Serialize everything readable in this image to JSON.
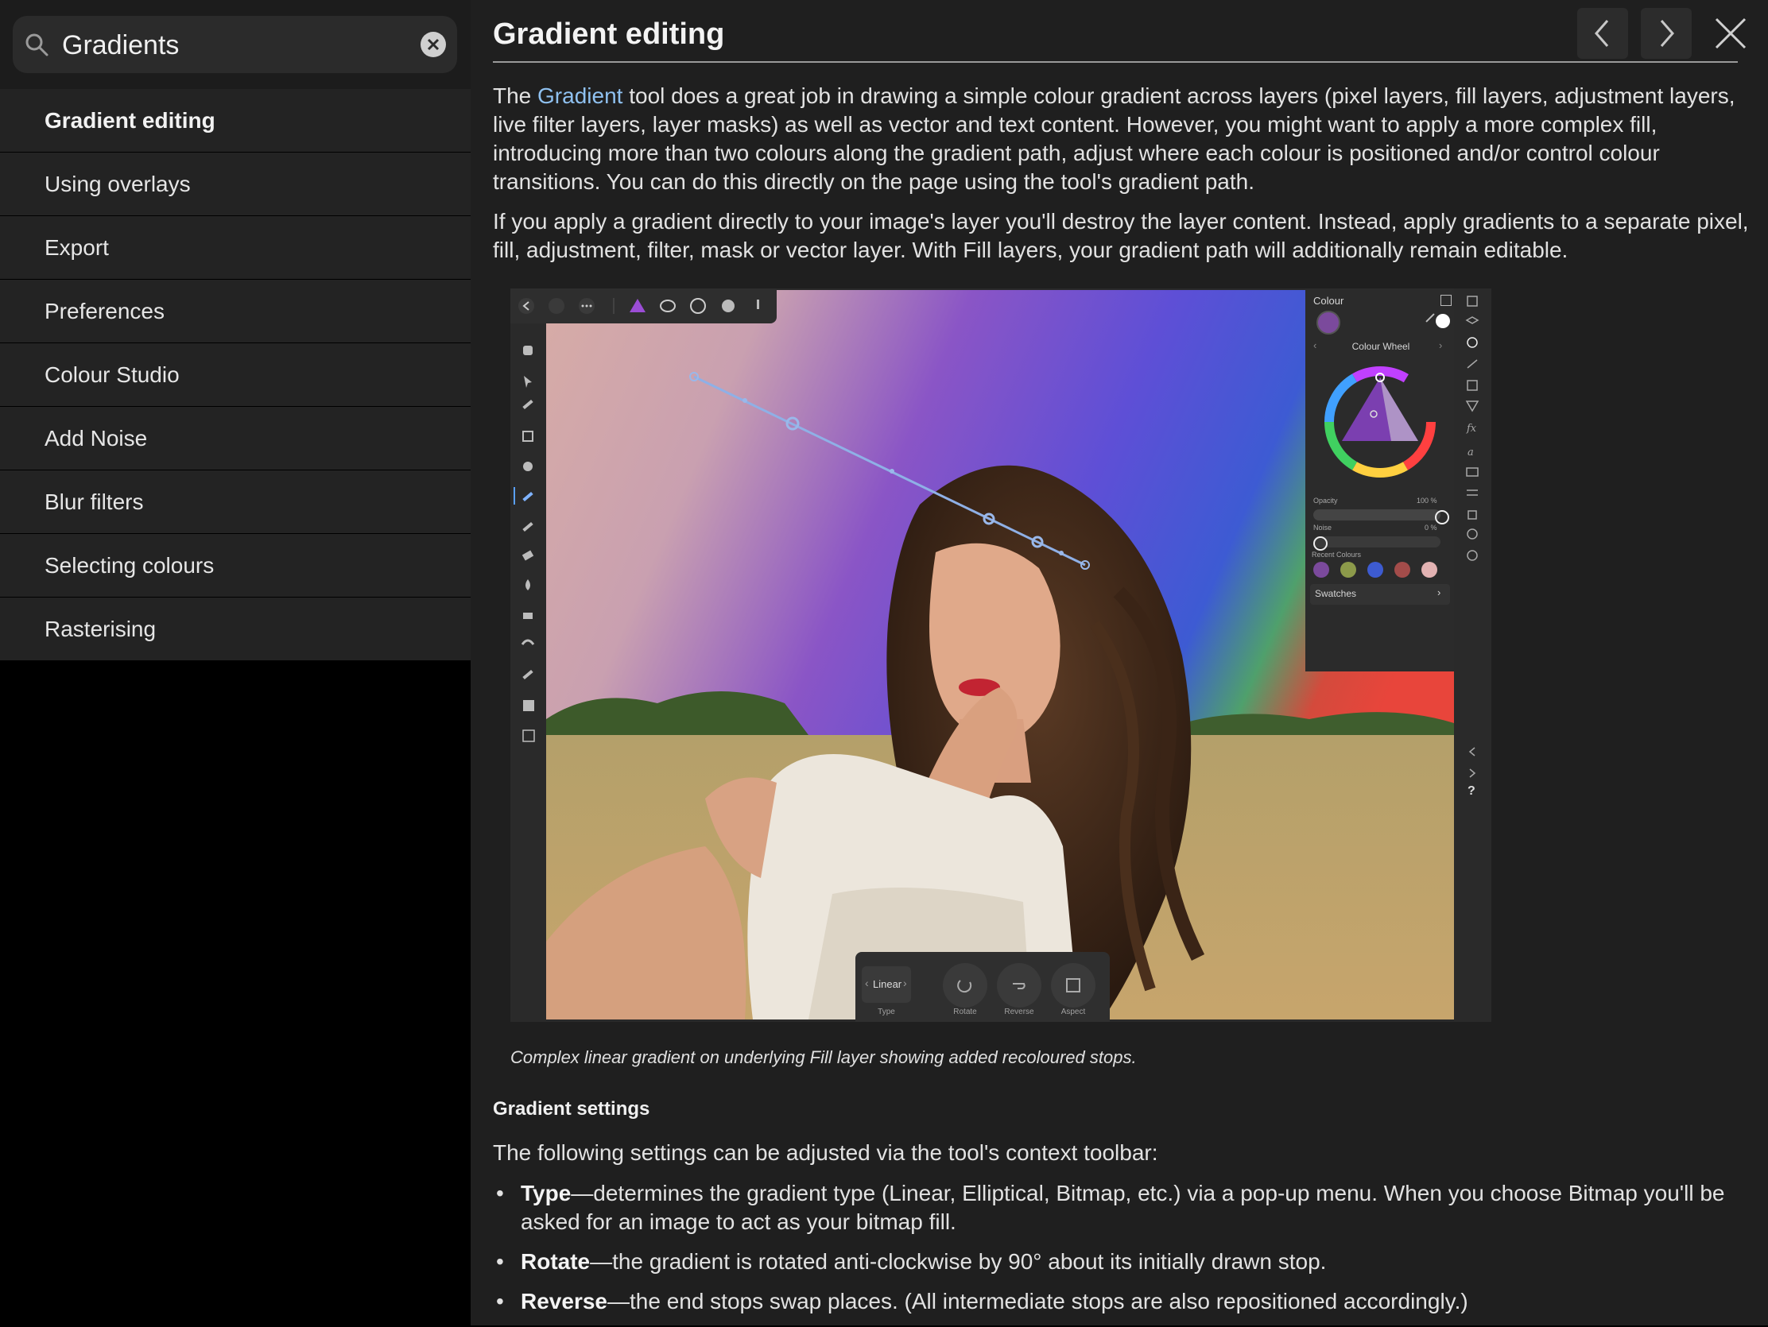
{
  "search": {
    "value": "Gradients"
  },
  "results": [
    "Gradient editing",
    "Using overlays",
    "Export",
    "Preferences",
    "Colour Studio",
    "Add Noise",
    "Blur filters",
    "Selecting colours",
    "Rasterising"
  ],
  "article": {
    "title": "Gradient editing",
    "p1_before": "The ",
    "p1_link": "Gradient",
    "p1_after": " tool does a great job in drawing a simple colour gradient across layers (pixel layers, fill layers, adjustment layers, live filter layers, layer masks) as well as vector and text content. However, you might want to apply a more complex fill, introducing more than two colours along the gradient path, adjust where each colour is positioned and/or control colour transitions. You can do this directly on the page using the tool's gradient path.",
    "p2": "If you apply a gradient directly to your image's layer you'll destroy the layer content. Instead, apply gradients to a separate pixel, fill, adjustment, filter, mask or vector layer. With Fill layers, your gradient path will additionally remain editable.",
    "caption": "Complex linear gradient on underlying Fill layer showing added recoloured stops.",
    "settings_heading": "Gradient settings",
    "p3": "The following settings can be adjusted via the tool's context toolbar:",
    "bullets": [
      {
        "term": "Type",
        "text": "—determines the gradient type (Linear, Elliptical, Bitmap, etc.) via a pop-up menu. When you choose Bitmap you'll be asked for an image to act as your bitmap fill."
      },
      {
        "term": "Rotate",
        "text": "—the gradient is rotated anti-clockwise by 90° about its initially drawn stop."
      },
      {
        "term": "Reverse",
        "text": "—the end stops swap places. (All intermediate stops are also repositioned accordingly.)"
      }
    ]
  },
  "screenshot": {
    "panel_title": "Colour",
    "mode": "Colour Wheel",
    "opacity_label": "Opacity",
    "opacity_value": "100 %",
    "noise_label": "Noise",
    "noise_value": "0 %",
    "recent_label": "Recent Colours",
    "swatches_label": "Swatches",
    "recent_colours": [
      "#7b4a9c",
      "#8c9a4a",
      "#3d5bd0",
      "#a34c4a",
      "#e2b2b2"
    ],
    "type_value": "Linear",
    "type_label": "Type",
    "rotate_label": "Rotate",
    "reverse_label": "Reverse",
    "aspect_label": "Aspect",
    "help_glyph": "?"
  },
  "colors": {
    "link": "#8fc1f0",
    "sidebar_item_bg": "#232323",
    "main_bg": "#1f1f1f"
  }
}
